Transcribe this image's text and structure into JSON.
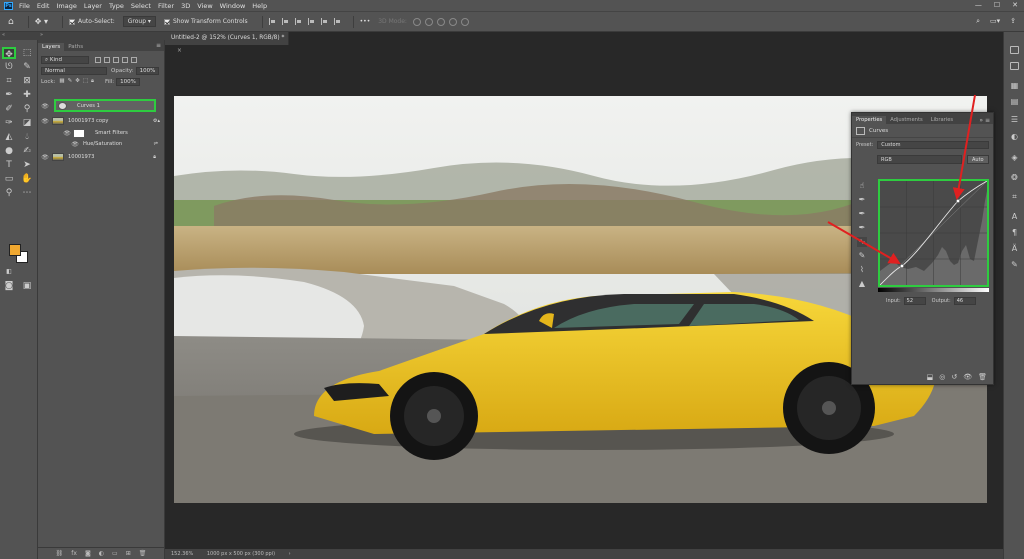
{
  "app": {
    "logo_text": "Ps",
    "menu": [
      "File",
      "Edit",
      "Image",
      "Layer",
      "Type",
      "Select",
      "Filter",
      "3D",
      "View",
      "Window",
      "Help"
    ],
    "window_controls": [
      "—",
      "☐",
      "✕"
    ]
  },
  "options_bar": {
    "auto_select_label": "Auto-Select:",
    "auto_select_value": "Group",
    "show_transform_label": "Show Transform Controls",
    "mode_3d_label": "3D Mode:",
    "more_label": "•••"
  },
  "layers_panel": {
    "tabs": [
      "Layers",
      "Paths"
    ],
    "filter_kind": "Kind",
    "blend_mode": "Normal",
    "opacity_label": "Opacity:",
    "opacity_value": "100%",
    "lock_label": "Lock:",
    "fill_label": "Fill:",
    "fill_value": "100%",
    "layers": [
      {
        "name": "Curves 1",
        "type": "adjustment"
      },
      {
        "name": "10001973 copy",
        "type": "smart-object"
      },
      {
        "name": "Smart Filters",
        "type": "smart-filters"
      },
      {
        "name": "Hue/Saturation",
        "type": "filter"
      },
      {
        "name": "10001973",
        "type": "image"
      }
    ]
  },
  "document": {
    "tab_title": "Untitled-2 @ 152% (Curves 1, RGB/8) *",
    "tab_close": "×",
    "zoom": "152.36%",
    "doc_size": "1000 px x 500 px (300 ppi)"
  },
  "properties_panel": {
    "tabs": [
      "Properties",
      "Adjustments",
      "Libraries"
    ],
    "title": "Curves",
    "preset_label": "Preset:",
    "preset_value": "Custom",
    "channel_value": "RGB",
    "auto_label": "Auto",
    "input_label": "Input:",
    "input_value": "52",
    "output_label": "Output:",
    "output_value": "46"
  },
  "colors": {
    "foreground": "#f0a830",
    "background": "#ffffff",
    "highlight": "#2ecc40",
    "arrow": "#e02020"
  }
}
